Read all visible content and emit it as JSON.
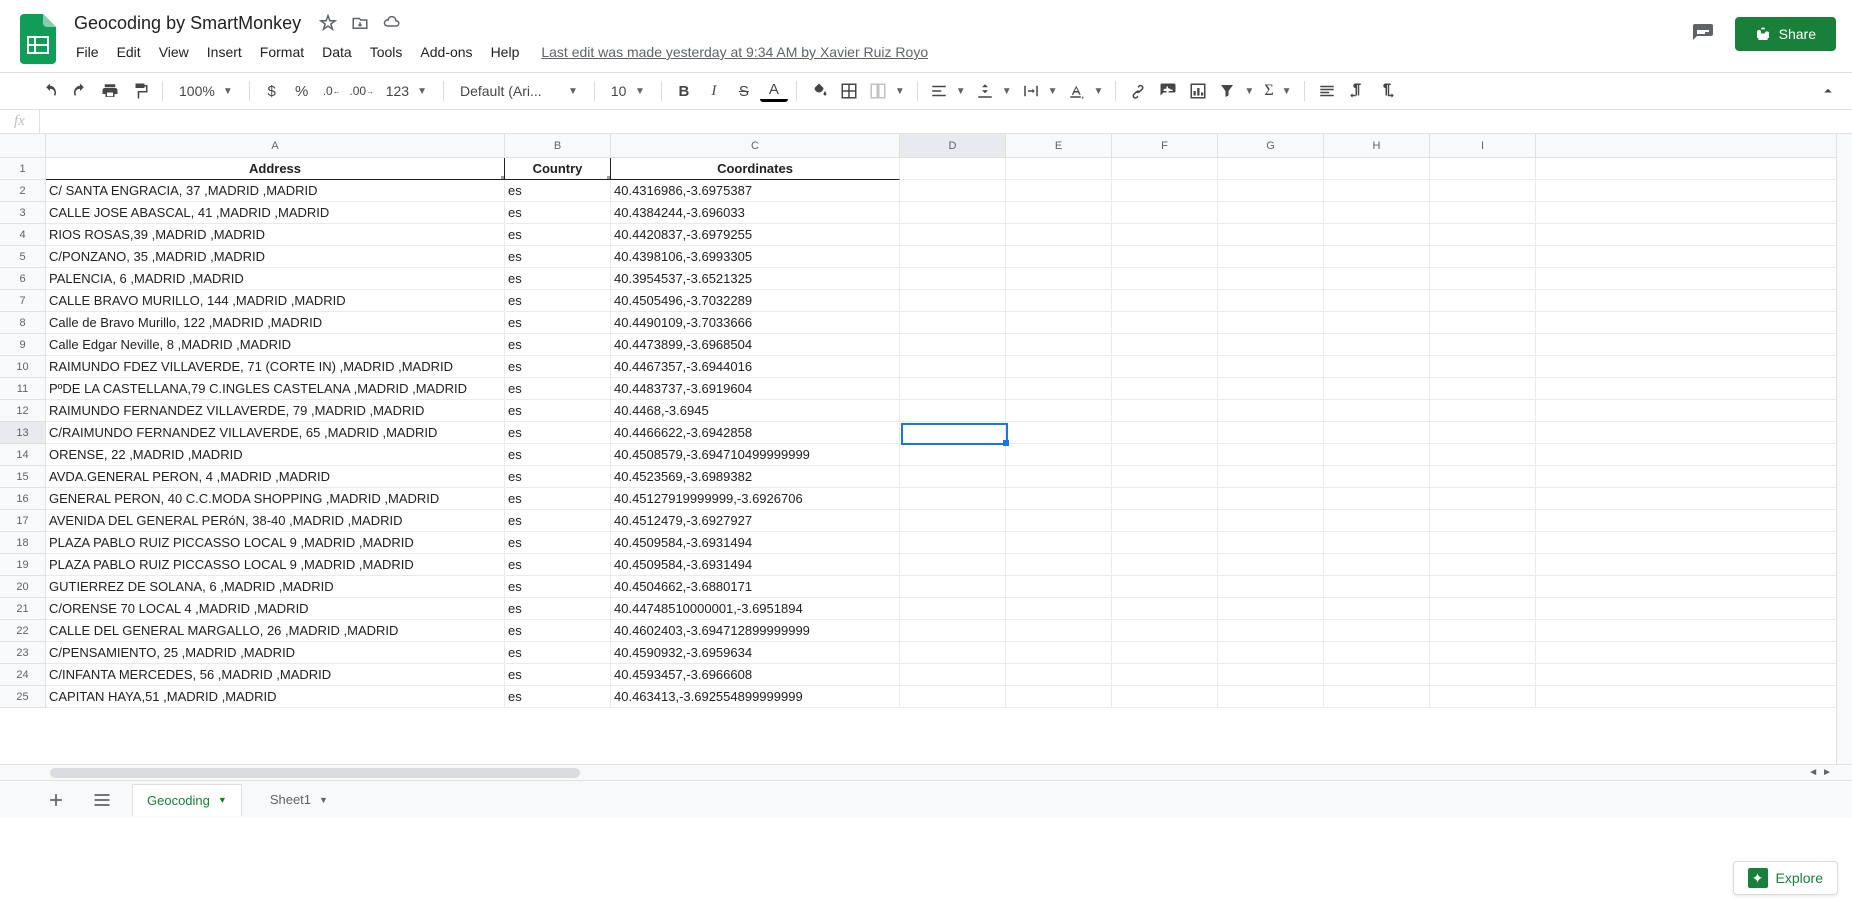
{
  "doc": {
    "title": "Geocoding by SmartMonkey",
    "last_edit": "Last edit was made yesterday at 9:34 AM by Xavier Ruiz Royo"
  },
  "menu": [
    "File",
    "Edit",
    "View",
    "Insert",
    "Format",
    "Data",
    "Tools",
    "Add-ons",
    "Help"
  ],
  "share_label": "Share",
  "toolbar": {
    "zoom": "100%",
    "font": "Default (Ari...",
    "font_size": "10",
    "more_formats": "123"
  },
  "formula_bar": {
    "value": ""
  },
  "columns": [
    "A",
    "B",
    "C",
    "D",
    "E",
    "F",
    "G",
    "H",
    "I"
  ],
  "selected_col": "D",
  "selected_row": 13,
  "table": {
    "headers": {
      "a": "Address",
      "b": "Country",
      "c": "Coordinates"
    },
    "rows": [
      {
        "a": "C/ SANTA ENGRACIA, 37 ,MADRID ,MADRID",
        "b": "es",
        "c": "40.4316986,-3.6975387"
      },
      {
        "a": "CALLE JOSE ABASCAL, 41 ,MADRID ,MADRID",
        "b": "es",
        "c": "40.4384244,-3.696033"
      },
      {
        "a": "RIOS ROSAS,39 ,MADRID ,MADRID",
        "b": "es",
        "c": "40.4420837,-3.6979255"
      },
      {
        "a": "C/PONZANO, 35 ,MADRID ,MADRID",
        "b": "es",
        "c": "40.4398106,-3.6993305"
      },
      {
        "a": "PALENCIA, 6 ,MADRID ,MADRID",
        "b": "es",
        "c": "40.3954537,-3.6521325"
      },
      {
        "a": "CALLE BRAVO MURILLO, 144 ,MADRID ,MADRID",
        "b": "es",
        "c": "40.4505496,-3.7032289"
      },
      {
        "a": "Calle de Bravo Murillo, 122 ,MADRID ,MADRID",
        "b": "es",
        "c": "40.4490109,-3.7033666"
      },
      {
        "a": "Calle Edgar Neville, 8 ,MADRID ,MADRID",
        "b": "es",
        "c": "40.4473899,-3.6968504"
      },
      {
        "a": "RAIMUNDO FDEZ VILLAVERDE, 71 (CORTE IN) ,MADRID ,MADRID",
        "b": "es",
        "c": "40.4467357,-3.6944016"
      },
      {
        "a": "PºDE LA CASTELLANA,79 C.INGLES CASTELANA ,MADRID ,MADRID",
        "b": "es",
        "c": "40.4483737,-3.6919604"
      },
      {
        "a": "RAIMUNDO FERNANDEZ VILLAVERDE, 79 ,MADRID ,MADRID",
        "b": "es",
        "c": "40.4468,-3.6945"
      },
      {
        "a": "C/RAIMUNDO FERNANDEZ VILLAVERDE, 65 ,MADRID ,MADRID",
        "b": "es",
        "c": "40.4466622,-3.6942858"
      },
      {
        "a": "ORENSE, 22 ,MADRID ,MADRID",
        "b": "es",
        "c": "40.4508579,-3.694710499999999"
      },
      {
        "a": "AVDA.GENERAL PERON, 4 ,MADRID ,MADRID",
        "b": "es",
        "c": "40.4523569,-3.6989382"
      },
      {
        "a": "GENERAL PERON, 40 C.C.MODA SHOPPING ,MADRID ,MADRID",
        "b": "es",
        "c": "40.45127919999999,-3.6926706"
      },
      {
        "a": "AVENIDA DEL GENERAL PERóN, 38-40 ,MADRID ,MADRID",
        "b": "es",
        "c": "40.4512479,-3.6927927"
      },
      {
        "a": "PLAZA PABLO RUIZ PICCASSO LOCAL 9 ,MADRID ,MADRID",
        "b": "es",
        "c": "40.4509584,-3.6931494"
      },
      {
        "a": "PLAZA PABLO RUIZ PICCASSO LOCAL 9 ,MADRID ,MADRID",
        "b": "es",
        "c": "40.4509584,-3.6931494"
      },
      {
        "a": "GUTIERREZ DE SOLANA, 6 ,MADRID ,MADRID",
        "b": "es",
        "c": "40.4504662,-3.6880171"
      },
      {
        "a": "C/ORENSE 70 LOCAL 4 ,MADRID ,MADRID",
        "b": "es",
        "c": "40.44748510000001,-3.6951894"
      },
      {
        "a": "CALLE DEL GENERAL MARGALLO, 26 ,MADRID ,MADRID",
        "b": "es",
        "c": "40.4602403,-3.694712899999999"
      },
      {
        "a": "C/PENSAMIENTO, 25 ,MADRID ,MADRID",
        "b": "es",
        "c": "40.4590932,-3.6959634"
      },
      {
        "a": "C/INFANTA MERCEDES, 56 ,MADRID ,MADRID",
        "b": "es",
        "c": "40.4593457,-3.6966608"
      },
      {
        "a": "CAPITAN HAYA,51 ,MADRID ,MADRID",
        "b": "es",
        "c": "40.463413,-3.692554899999999"
      }
    ]
  },
  "sheets": [
    {
      "name": "Geocoding",
      "active": true
    },
    {
      "name": "Sheet1",
      "active": false
    }
  ],
  "explore_label": "Explore",
  "chart_data": {
    "type": "table",
    "note": "spreadsheet — see table.rows for data"
  }
}
